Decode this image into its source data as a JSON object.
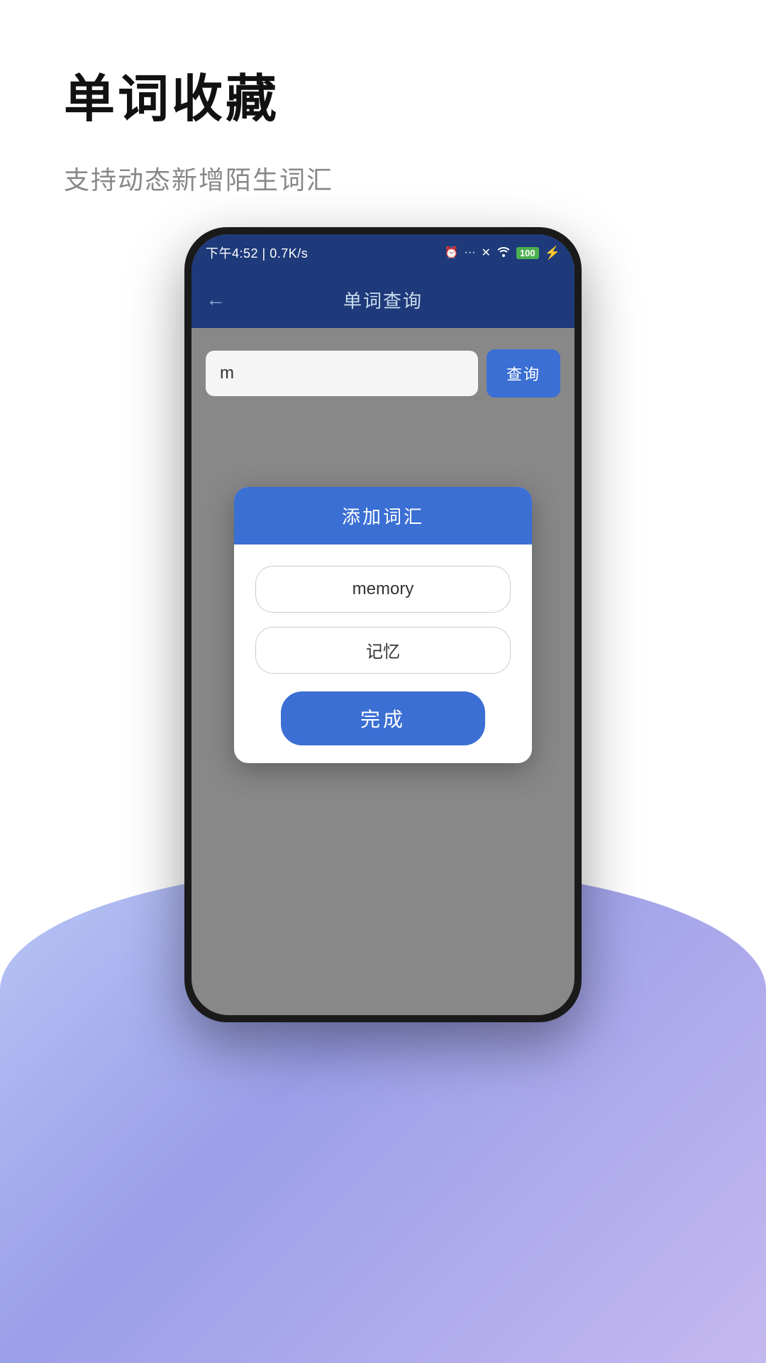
{
  "page": {
    "title": "单词收藏",
    "subtitle": "支持动态新增陌生词汇"
  },
  "status_bar": {
    "time": "下午4:52 | 0.7K/s",
    "alarm_icon": "⏰",
    "more_icon": "···",
    "close_icon": "✕",
    "wifi_icon": "WiFi",
    "battery_text": "100",
    "battery_icon": "🔋"
  },
  "app_bar": {
    "back_icon": "←",
    "title": "单词查询"
  },
  "search": {
    "input_value": "m",
    "button_label": "查询"
  },
  "dialog": {
    "header": "添加词汇",
    "word_field": "memory",
    "translation_field": "记忆",
    "confirm_button": "完成"
  }
}
